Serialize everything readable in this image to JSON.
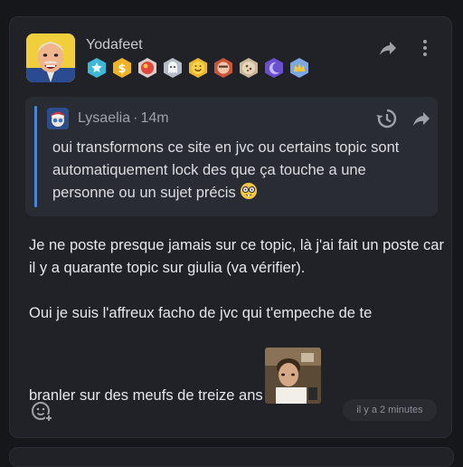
{
  "post": {
    "username": "Yodafeet",
    "avatar_icon": "laughing-man-avatar",
    "badges": [
      {
        "icon": "star-badge-icon",
        "color": "#3fb7d6"
      },
      {
        "icon": "dollar-badge-icon",
        "color": "#f0b323"
      },
      {
        "icon": "fire-badge-icon",
        "color": "#e2463d"
      },
      {
        "icon": "ghost-badge-icon",
        "color": "#c9ccd2"
      },
      {
        "icon": "smile-badge-icon",
        "color": "#f3c63b"
      },
      {
        "icon": "face-badge-icon",
        "color": "#e48a5b"
      },
      {
        "icon": "cookie-badge-icon",
        "color": "#d8c4a3"
      },
      {
        "icon": "moon-badge-icon",
        "color": "#7b5bd6"
      },
      {
        "icon": "crown-badge-icon",
        "color": "#7da7e0"
      }
    ],
    "quote": {
      "author": "Lysaelia",
      "separator": "·",
      "time": "14m",
      "text": "oui transformons ce site en jvc ou certains topic sont automatiquement lock des que ça touche a une personne ou un sujet précis"
    },
    "body": {
      "p1": "Je ne poste presque jamais sur ce topic, là j'ai fait un poste car il y a quarante topic sur giulia (va vérifier).",
      "p2": "Oui je suis l'affreux facho de jvc qui t'empeche de te",
      "p3": "branler sur des meufs de treize ans"
    },
    "timestamp": "il y a 2 minutes"
  },
  "colors": {
    "background": "#16171b",
    "card": "#212227",
    "quote_bg": "#2a2c33",
    "quote_bar": "#4a86d8"
  }
}
